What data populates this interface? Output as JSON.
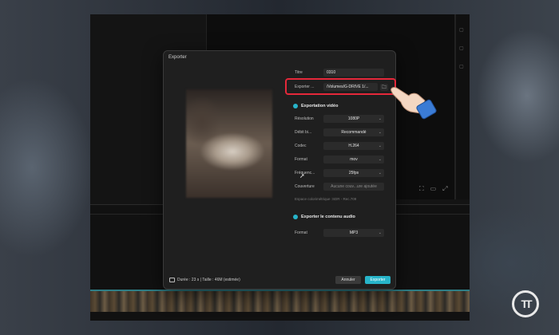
{
  "dialog": {
    "title": "Exporter",
    "fields": {
      "title_label": "Titre",
      "title_value": "0310",
      "export_label": "Exporter ...",
      "export_path": "/Volumes/G-DRIVE 1/..."
    },
    "video_section": {
      "label": "Exportation vidéo",
      "rows": [
        {
          "label": "Résolution",
          "value": "1080P"
        },
        {
          "label": "Débit bi...",
          "value": "Recommandé"
        },
        {
          "label": "Codec",
          "value": "H.264"
        },
        {
          "label": "Format",
          "value": "mov"
        },
        {
          "label": "Fréquenc...",
          "value": "25fps"
        }
      ],
      "cover_label": "Couverture",
      "cover_value": "Aucune couv...ure ajoutée",
      "color_space": "Espace colorimétrique :SDR - Rec.709"
    },
    "audio_section": {
      "label": "Exporter le contenu audio",
      "format_label": "Format",
      "format_value": "MP3"
    },
    "footer": {
      "info": "Durée : 23 s | Taille : 46M (estimée)",
      "cancel_label": "Annuler",
      "export_label": "Exporter"
    }
  },
  "logo_text": "TT",
  "colors": {
    "accent": "#27b4c9",
    "highlight": "#e5283a"
  }
}
